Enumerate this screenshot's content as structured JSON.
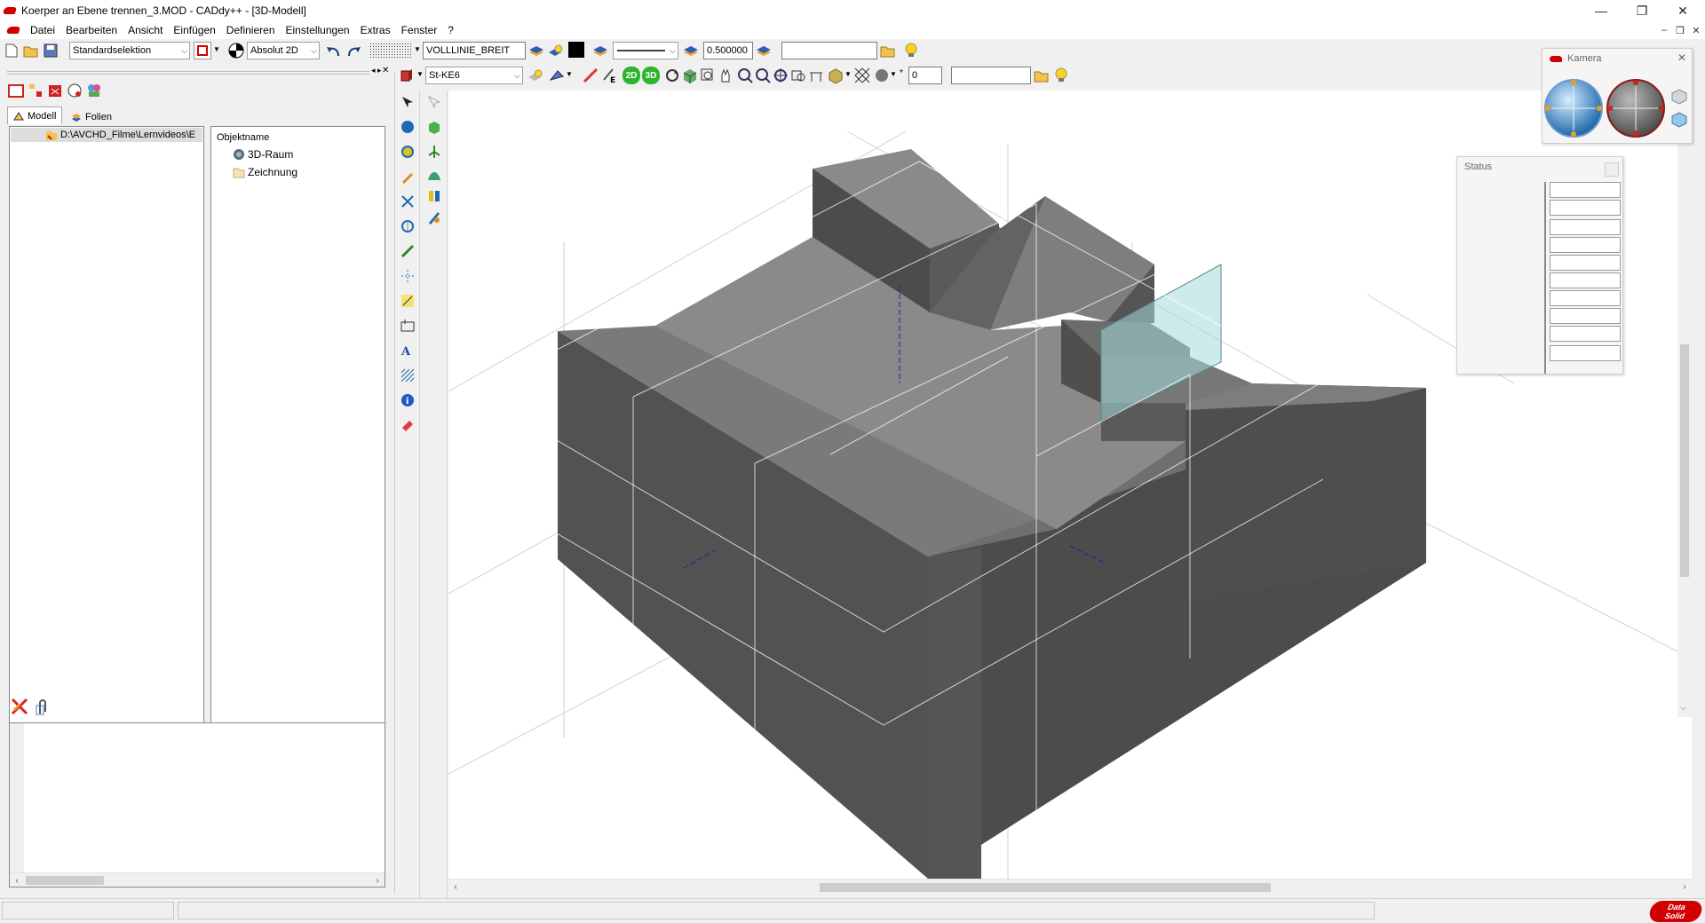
{
  "window": {
    "title": "Koerper an Ebene trennen_3.MOD  -  CADdy++ - [3D-Modell]",
    "minimize": "—",
    "restore": "❐",
    "close": "✕"
  },
  "menu": {
    "items": [
      "Datei",
      "Bearbeiten",
      "Ansicht",
      "Einfügen",
      "Definieren",
      "Einstellungen",
      "Extras",
      "Fenster",
      "?"
    ]
  },
  "toolbar1": {
    "selection_mode": "Standardselektion",
    "coord_mode": "Absolut 2D",
    "linetype": "VOLLLINIE_BREIT",
    "line_width": "0.500000",
    "empty_field": ""
  },
  "toolbar2": {
    "material": "St-KE6",
    "view_2d": "2D",
    "view_3d": "3D",
    "count": "0",
    "empty_field": ""
  },
  "left_panel": {
    "tabs": [
      "Modell",
      "Folien"
    ],
    "file_path": "D:\\AVCHD_Filme\\Lernvideos\\E",
    "object_header": "Objektname",
    "objects": [
      "3D-Raum",
      "Zeichnung"
    ]
  },
  "camera_window": {
    "title": "Kamera"
  },
  "status_window": {
    "title": "Status",
    "rows": 10
  },
  "brand": {
    "logo_text_1": "Data",
    "logo_text_2": "Solid"
  },
  "colors": {
    "accent_red": "#d10000",
    "model_top": "#8a8a8a",
    "model_side_dark": "#4f4f4f",
    "model_side_mid": "#5a5a5a",
    "plane_tint": "#a6dadb"
  }
}
